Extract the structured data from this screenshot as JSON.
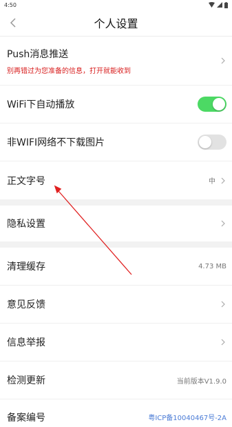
{
  "status_bar": {
    "time": "4:50"
  },
  "header": {
    "title": "个人设置"
  },
  "settings": {
    "push": {
      "label": "Push消息推送",
      "sub": "别再错过为您准备的信息，打开就能收到"
    },
    "wifi_autoplay": {
      "label": "WiFi下自动播放",
      "on": true
    },
    "no_wifi_images": {
      "label": "非WIFI网络不下载图片",
      "on": false
    },
    "font_size": {
      "label": "正文字号",
      "value": "中"
    },
    "privacy": {
      "label": "隐私设置"
    },
    "cache": {
      "label": "清理缓存",
      "value": "4.73 MB"
    },
    "feedback": {
      "label": "意见反馈"
    },
    "report": {
      "label": "信息举报"
    },
    "update": {
      "label": "检测更新",
      "value": "当前版本V1.9.0"
    },
    "beian": {
      "label": "备案编号",
      "value": "粤ICP备10040467号-2A"
    }
  },
  "colors": {
    "toggle_on": "#4cd964",
    "toggle_off": "#e2e2e2",
    "accent_red": "#d81e1e",
    "link_blue": "#4a7bd6",
    "annotation_arrow": "#e02020"
  }
}
